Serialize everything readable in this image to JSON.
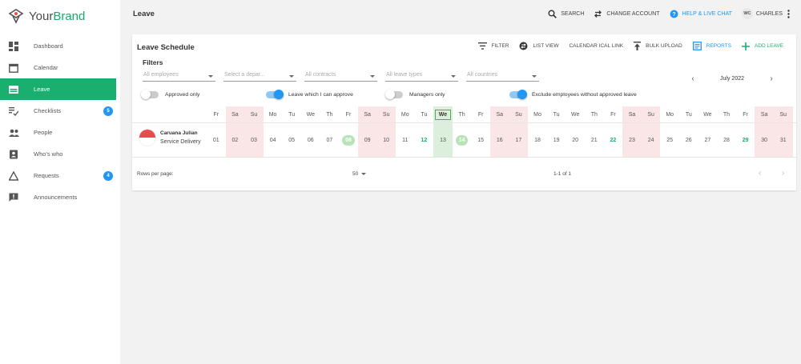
{
  "brand": {
    "name_a": "Your",
    "name_b": "Brand",
    "accent_color": "#1aae6f"
  },
  "sidebar": {
    "items": [
      {
        "label": "Dashboard",
        "icon": "dashboard-icon"
      },
      {
        "label": "Calendar",
        "icon": "calendar-icon"
      },
      {
        "label": "Leave",
        "icon": "leave-icon",
        "active": true
      },
      {
        "label": "Checklists",
        "icon": "checklist-icon",
        "badge": "5"
      },
      {
        "label": "People",
        "icon": "people-icon"
      },
      {
        "label": "Who's who",
        "icon": "contact-badge-icon"
      },
      {
        "label": "Requests",
        "icon": "warning-icon",
        "badge": "4"
      },
      {
        "label": "Announcements",
        "icon": "announcement-icon"
      }
    ]
  },
  "topbar": {
    "title": "Leave",
    "search": "SEARCH",
    "change_account": "CHANGE ACCOUNT",
    "help": "HELP & LIVE CHAT",
    "user_initials": "WC",
    "user_name": "CHARLES"
  },
  "card": {
    "title": "Leave Schedule",
    "actions": {
      "filter": "FILTER",
      "list_view": "LIST VIEW",
      "ical": "CALENDAR ICAL LINK",
      "bulk_upload": "BULK UPLOAD",
      "reports": "REPORTS",
      "add_leave": "ADD LEAVE"
    },
    "filters_label": "Filters",
    "filters": [
      "All employees",
      "Select a depar...",
      "All contracts",
      "All leave types",
      "All countries"
    ],
    "month": "July 2022",
    "toggles": [
      {
        "label": "Approved only",
        "on": false
      },
      {
        "label": "Leave which I can approve",
        "on": true
      },
      {
        "label": "Managers only",
        "on": false
      },
      {
        "label": "Exclude employees without approved leave",
        "on": true
      }
    ]
  },
  "schedule": {
    "days": [
      "Fr",
      "Sa",
      "Su",
      "Mo",
      "Tu",
      "We",
      "Th",
      "Fr",
      "Sa",
      "Su",
      "Mo",
      "Tu",
      "We",
      "Th",
      "Fr",
      "Sa",
      "Su",
      "Mo",
      "Tu",
      "We",
      "Th",
      "Fr",
      "Sa",
      "Su",
      "Mo",
      "Tu",
      "We",
      "Th",
      "Fr",
      "Sa",
      "Su"
    ],
    "dates": [
      "01",
      "02",
      "03",
      "04",
      "05",
      "06",
      "07",
      "08",
      "09",
      "10",
      "11",
      "12",
      "13",
      "14",
      "15",
      "16",
      "17",
      "18",
      "19",
      "20",
      "21",
      "22",
      "23",
      "24",
      "25",
      "26",
      "27",
      "28",
      "29",
      "30",
      "31"
    ],
    "weekend_indexes": [
      1,
      2,
      8,
      9,
      15,
      16,
      22,
      23,
      29,
      30
    ],
    "today_index": 12,
    "leave_indexes": [
      7,
      13
    ],
    "bold_indexes": [
      11,
      21,
      28
    ],
    "employee": {
      "name": "Caruana Julian",
      "department": "Service Delivery"
    }
  },
  "footer": {
    "rows_per_page_label": "Rows per page:",
    "rows_per_page": "50",
    "count": "1-1 of 1"
  }
}
